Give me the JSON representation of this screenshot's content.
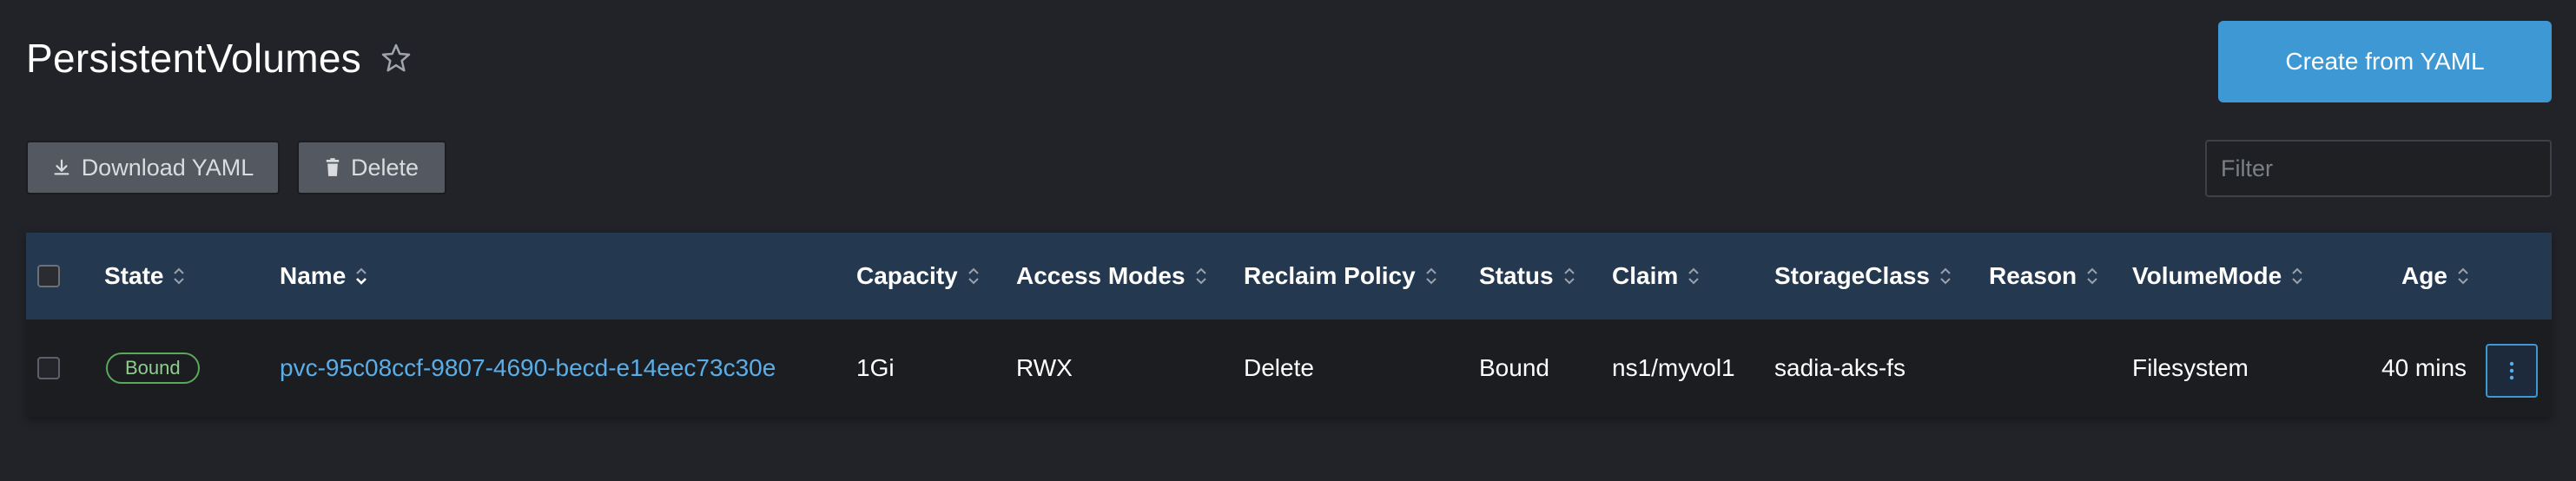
{
  "header": {
    "title": "PersistentVolumes",
    "create_label": "Create from YAML"
  },
  "toolbar": {
    "download_label": "Download YAML",
    "delete_label": "Delete",
    "filter_placeholder": "Filter",
    "filter_value": ""
  },
  "table": {
    "columns": {
      "state": "State",
      "name": "Name",
      "capacity": "Capacity",
      "access_modes": "Access Modes",
      "reclaim_policy": "Reclaim Policy",
      "status": "Status",
      "claim": "Claim",
      "storage_class": "StorageClass",
      "reason": "Reason",
      "volume_mode": "VolumeMode",
      "age": "Age"
    },
    "rows": [
      {
        "state": "Bound",
        "name": "pvc-95c08ccf-9807-4690-becd-e14eec73c30e",
        "capacity": "1Gi",
        "access_modes": "RWX",
        "reclaim_policy": "Delete",
        "status": "Bound",
        "claim": "ns1/myvol1",
        "storage_class": "sadia-aks-fs",
        "reason": "",
        "volume_mode": "Filesystem",
        "age": "40 mins"
      }
    ]
  },
  "icons": {
    "favorite": "star-icon",
    "download": "download-icon",
    "delete": "trash-icon",
    "sort": "sort-arrows-icon",
    "row_actions": "kebab-menu-icon"
  },
  "colors": {
    "background": "#222328",
    "primary_button": "#3d98d3",
    "table_header": "#243850",
    "link": "#5aaee8",
    "bound_badge": "#5aa85c"
  }
}
